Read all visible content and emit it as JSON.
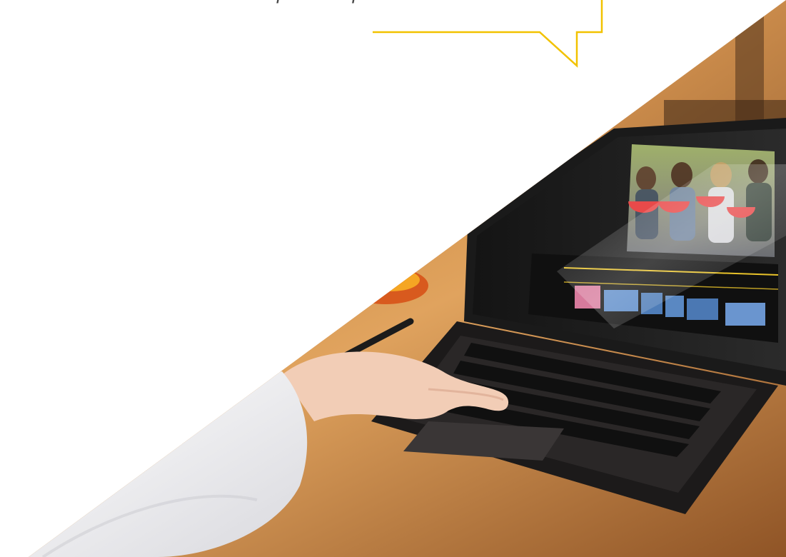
{
  "quote": {
    "visible_line": "para el profesional de esta área."
  },
  "colors": {
    "accent_yellow": "#f2c200",
    "text_gray": "#4a4a4a",
    "background": "#ffffff"
  },
  "image": {
    "subject": "hands-typing-on-laptop-video-editing-icon"
  }
}
